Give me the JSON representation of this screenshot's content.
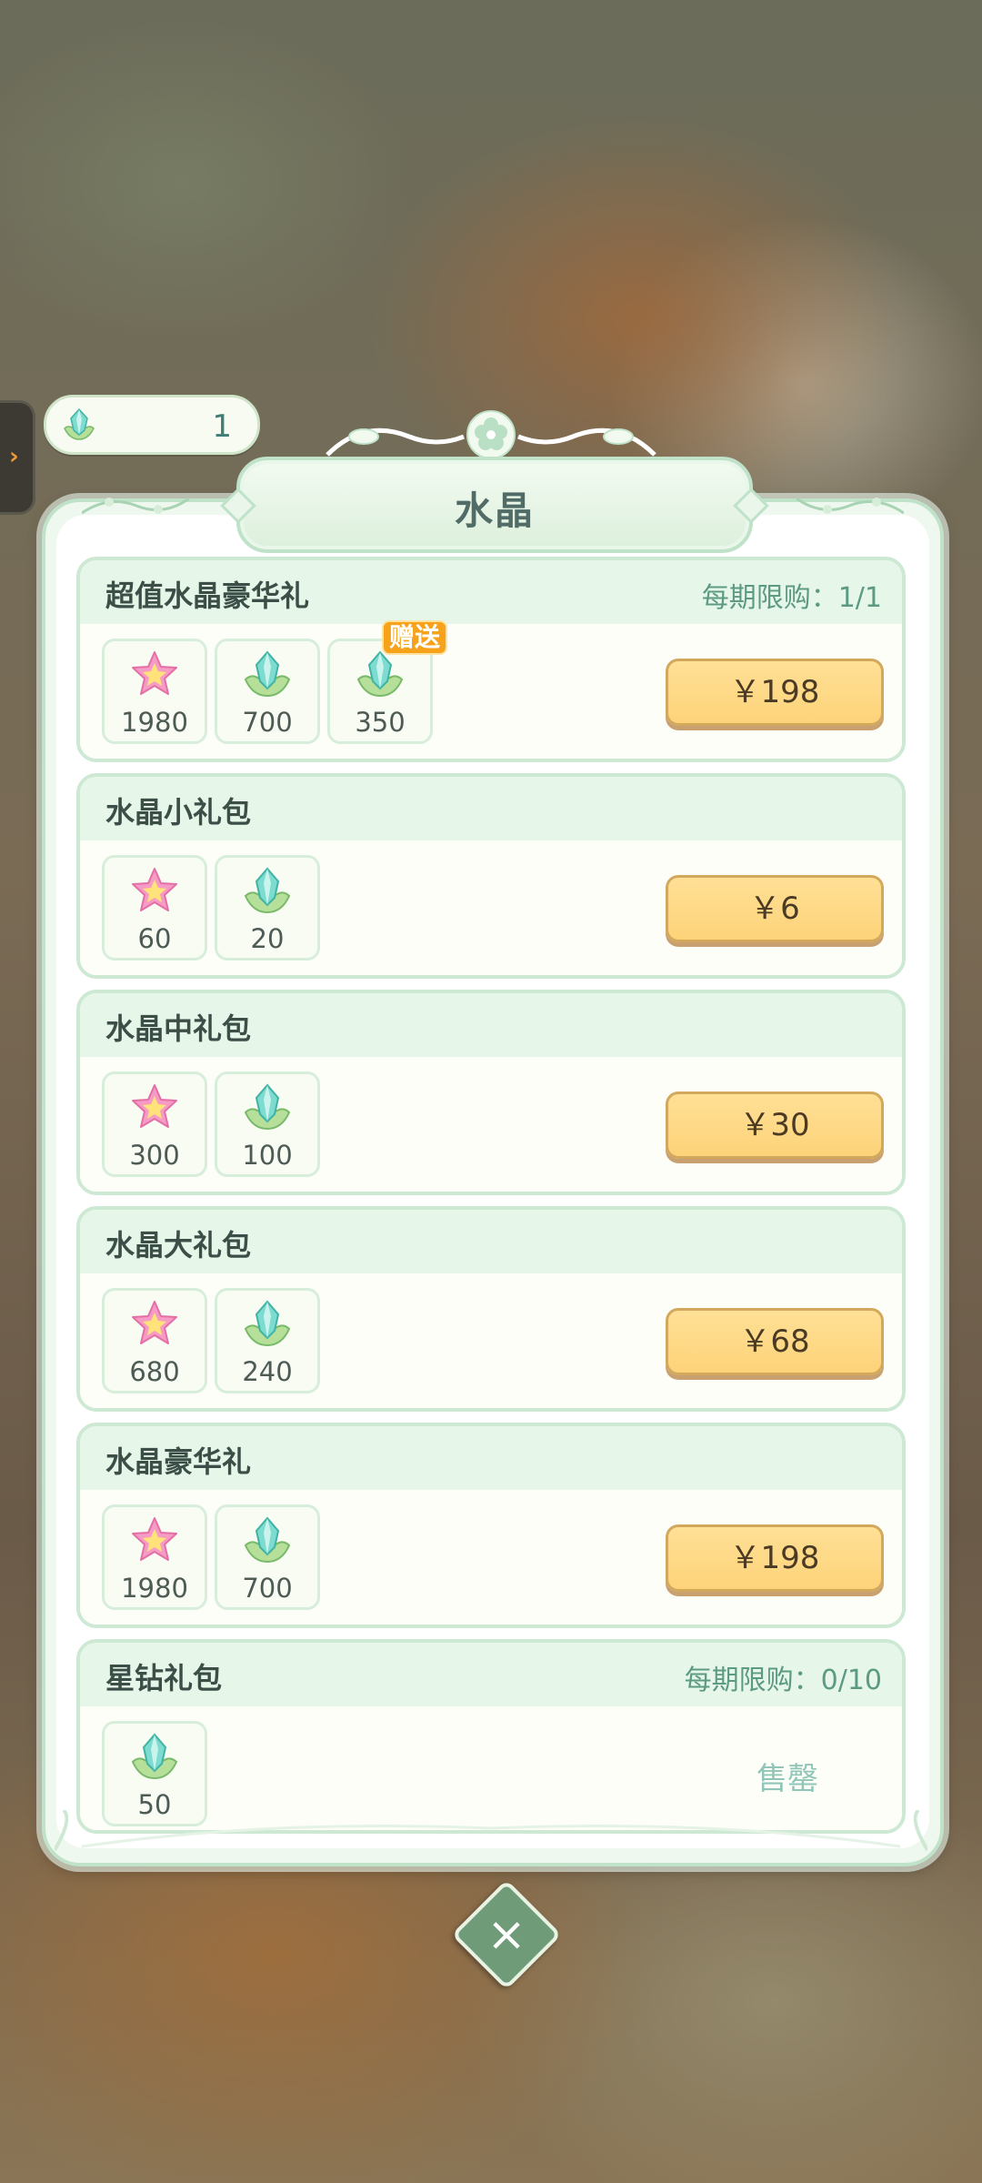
{
  "currency": {
    "icon": "crystal-icon",
    "amount": "1"
  },
  "title": "水晶",
  "packages": [
    {
      "name": "超值水晶豪华礼",
      "limit": "每期限购：1/1",
      "items": [
        {
          "icon": "star-icon",
          "qty": "1980"
        },
        {
          "icon": "crystal-icon",
          "qty": "700"
        },
        {
          "icon": "crystal-icon",
          "qty": "350",
          "tag": "赠送"
        }
      ],
      "price": "￥198"
    },
    {
      "name": "水晶小礼包",
      "items": [
        {
          "icon": "star-icon",
          "qty": "60"
        },
        {
          "icon": "crystal-icon",
          "qty": "20"
        }
      ],
      "price": "￥6"
    },
    {
      "name": "水晶中礼包",
      "items": [
        {
          "icon": "star-icon",
          "qty": "300"
        },
        {
          "icon": "crystal-icon",
          "qty": "100"
        }
      ],
      "price": "￥30"
    },
    {
      "name": "水晶大礼包",
      "items": [
        {
          "icon": "star-icon",
          "qty": "680"
        },
        {
          "icon": "crystal-icon",
          "qty": "240"
        }
      ],
      "price": "￥68"
    },
    {
      "name": "水晶豪华礼",
      "items": [
        {
          "icon": "star-icon",
          "qty": "1980"
        },
        {
          "icon": "crystal-icon",
          "qty": "700"
        }
      ],
      "price": "￥198"
    },
    {
      "name": "星钻礼包",
      "limit": "每期限购：0/10",
      "items": [
        {
          "icon": "crystal-icon",
          "qty": "50"
        }
      ],
      "status": "售罄"
    }
  ],
  "close": {
    "icon": "close-icon",
    "label": "×"
  },
  "colors": {
    "accent": "#5d9a84",
    "button": "#fdd379",
    "gift_tag": "#f6a21b"
  }
}
